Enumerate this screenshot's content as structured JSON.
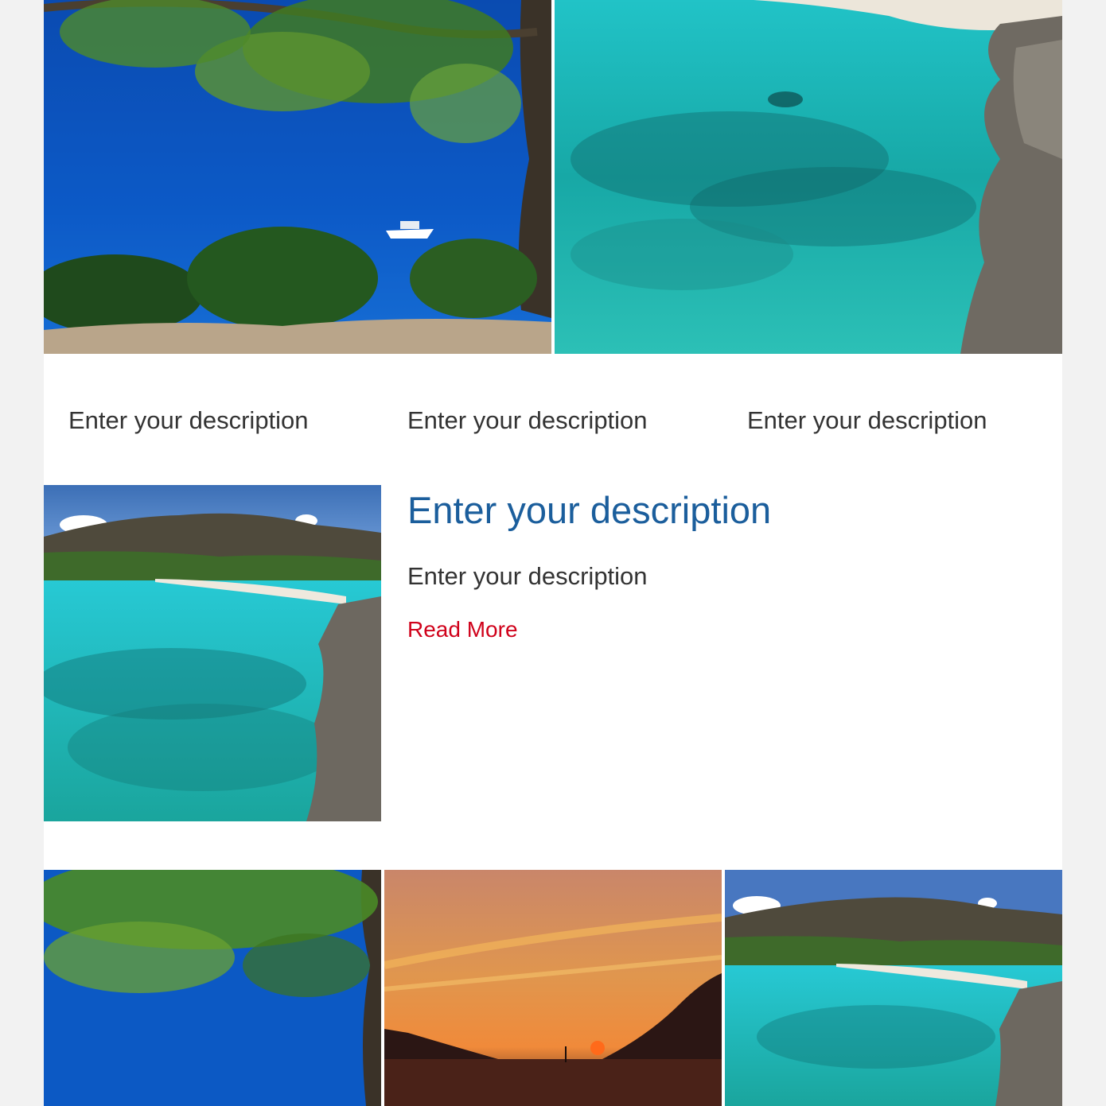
{
  "images": {
    "top_left": "pine-tree-over-blue-sea-with-boat",
    "top_right": "turquoise-bay-with-rocky-cliff",
    "feature": "beach-cove-with-hills",
    "bottom_1": "pine-tree-over-blue-sea",
    "bottom_2": "sunset-over-sea-with-sailboat",
    "bottom_3": "beach-cove-with-hills"
  },
  "descriptions": [
    "Enter your description",
    "Enter your description",
    "Enter your description"
  ],
  "feature": {
    "title": "Enter your description",
    "text": "Enter your description",
    "link_label": "Read More"
  },
  "colors": {
    "page_background": "#f2f2f2",
    "content_background": "#ffffff",
    "title": "#1b5e9c",
    "body_text": "#333333",
    "link": "#d0021b"
  }
}
